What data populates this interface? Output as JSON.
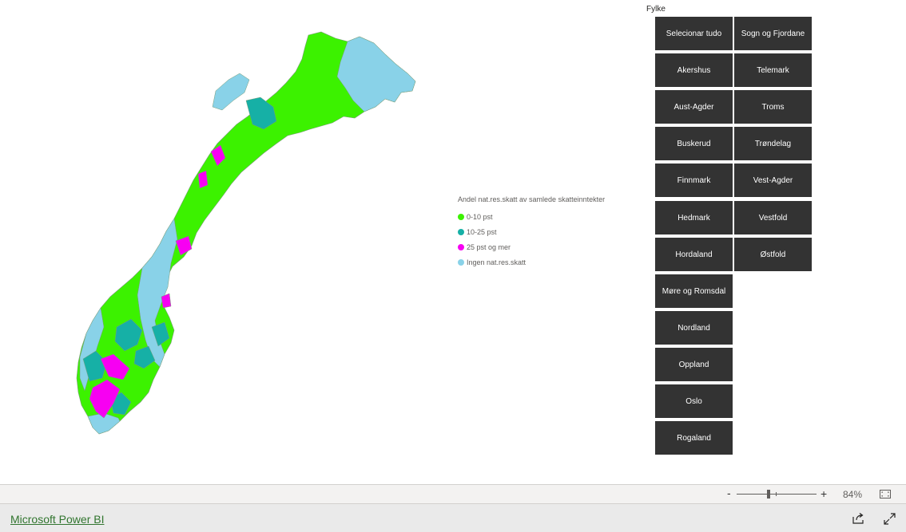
{
  "colors": {
    "cat_0_10": "#3cf200",
    "cat_10_25": "#16b0a6",
    "cat_25_plus": "#f700f2",
    "cat_none": "#89d2e8",
    "slicer_bg": "#333333",
    "link": "#31752f"
  },
  "map": {
    "region": "Norway municipalities"
  },
  "legend": {
    "title": "Andel nat.res.skatt av samlede skatteinntekter",
    "items": [
      "0-10 pst",
      "10-25 pst",
      "25 pst og mer",
      "Ingen nat.res.skatt"
    ]
  },
  "slicer": {
    "title": "Fylke",
    "buttons": [
      "Selecionar tudo",
      "Sogn og Fjordane",
      "Akershus",
      "Telemark",
      "Aust-Agder",
      "Troms",
      "Buskerud",
      "Trøndelag",
      "Finnmark",
      "Vest-Agder",
      "Hedmark",
      "Vestfold",
      "Hordaland",
      "Østfold",
      "Møre og Romsdal",
      "Nordland",
      "Oppland",
      "Oslo",
      "Rogaland"
    ]
  },
  "zoom": {
    "minus": "-",
    "plus": "+",
    "value": "84%",
    "level": 0.4
  },
  "footer": {
    "brand": "Microsoft Power BI"
  },
  "icons": {
    "fit": "fit-to-page-icon",
    "share": "share-icon",
    "expand": "expand-icon"
  }
}
